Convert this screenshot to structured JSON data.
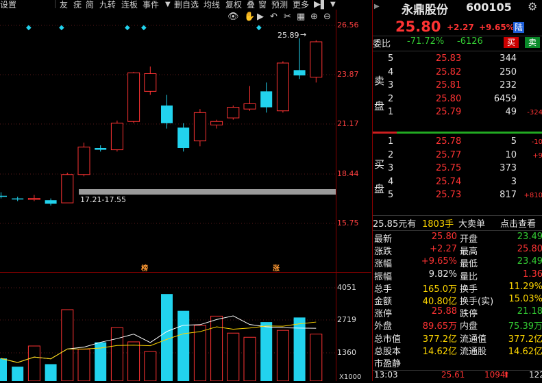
{
  "toolbar": {
    "items": [
      "设置",
      "友",
      "疣",
      "简",
      "九转",
      "连板",
      "事件",
      "删自选",
      "均线",
      "复权",
      "叠",
      "窗",
      "预测",
      "更多"
    ]
  },
  "chart": {
    "price_labels": [
      "26.56",
      "23.87",
      "21.17",
      "18.44",
      "15.75"
    ],
    "volume_labels": [
      "4051",
      "2719",
      "1360",
      "X1000"
    ],
    "high_label": "25.89",
    "range_label": "17.21-17.55",
    "bottom_markers": [
      "榜",
      "涨"
    ],
    "colors": {
      "up": "#ff3333",
      "down": "#22d3ee",
      "ma1": "#ffffff",
      "ma2": "#ffd700"
    }
  },
  "chart_data": {
    "type": "candlestick",
    "candles": [
      {
        "o": 17.1,
        "c": 17.05,
        "h": 17.3,
        "l": 16.95
      },
      {
        "o": 16.95,
        "c": 16.9,
        "h": 17.05,
        "l": 16.8
      },
      {
        "o": 16.9,
        "c": 16.95,
        "h": 17.15,
        "l": 16.8
      },
      {
        "o": 16.85,
        "c": 16.65,
        "h": 16.95,
        "l": 16.55
      },
      {
        "o": 16.7,
        "c": 18.3,
        "h": 18.4,
        "l": 16.7
      },
      {
        "o": 18.3,
        "c": 19.85,
        "h": 20.1,
        "l": 18.2
      },
      {
        "o": 19.8,
        "c": 19.7,
        "h": 19.95,
        "l": 19.6
      },
      {
        "o": 19.7,
        "c": 21.2,
        "h": 21.35,
        "l": 19.6
      },
      {
        "o": 21.3,
        "c": 24.05,
        "h": 24.1,
        "l": 21.2
      },
      {
        "o": 23.0,
        "c": 24.0,
        "h": 24.4,
        "l": 22.8
      },
      {
        "o": 22.2,
        "c": 21.2,
        "h": 22.8,
        "l": 20.9
      },
      {
        "o": 20.95,
        "c": 19.8,
        "h": 21.2,
        "l": 19.6
      },
      {
        "o": 20.2,
        "c": 21.8,
        "h": 22.0,
        "l": 19.9
      },
      {
        "o": 21.1,
        "c": 21.3,
        "h": 21.4,
        "l": 20.9
      },
      {
        "o": 21.5,
        "c": 22.1,
        "h": 22.2,
        "l": 21.4
      },
      {
        "o": 22.0,
        "c": 22.3,
        "h": 23.3,
        "l": 21.9
      },
      {
        "o": 23.0,
        "c": 22.1,
        "h": 23.5,
        "l": 21.8
      },
      {
        "o": 21.9,
        "c": 24.6,
        "h": 24.7,
        "l": 21.8
      },
      {
        "o": 24.2,
        "c": 23.9,
        "h": 26.0,
        "l": 23.7
      },
      {
        "o": 23.8,
        "c": 25.8,
        "h": 25.89,
        "l": 23.5
      }
    ],
    "volume": [
      980,
      620,
      1520,
      730,
      3100,
      1380,
      1680,
      2320,
      1700,
      1280,
      3780,
      3050,
      2420,
      2820,
      2080,
      1900,
      2560,
      2200,
      2760,
      2040
    ],
    "ylim": [
      15.0,
      27.0
    ],
    "vol_max": 4500
  },
  "stock": {
    "name": "永鼎股份",
    "code": "600105",
    "price": "25.80",
    "change": "+2.27",
    "change_pct": "+9.65%",
    "badge": "陆",
    "weibi_label": "委比",
    "weibi": "-71.72%",
    "weicha": "-6126",
    "buy_btn": "买",
    "sell_btn": "卖"
  },
  "orderbook": {
    "sell_label": [
      "卖",
      "盘"
    ],
    "buy_label": [
      "买",
      "盘"
    ],
    "sells": [
      {
        "level": "5",
        "price": "25.83",
        "vol": "344",
        "delta": ""
      },
      {
        "level": "4",
        "price": "25.82",
        "vol": "250",
        "delta": ""
      },
      {
        "level": "3",
        "price": "25.81",
        "vol": "232",
        "delta": ""
      },
      {
        "level": "2",
        "price": "25.80",
        "vol": "6459",
        "delta": ""
      },
      {
        "level": "1",
        "price": "25.79",
        "vol": "49",
        "delta": "-324"
      }
    ],
    "buys": [
      {
        "level": "1",
        "price": "25.78",
        "vol": "5",
        "delta": "-10"
      },
      {
        "level": "2",
        "price": "25.77",
        "vol": "10",
        "delta": "+9"
      },
      {
        "level": "3",
        "price": "25.75",
        "vol": "373",
        "delta": ""
      },
      {
        "level": "4",
        "price": "25.74",
        "vol": "3",
        "delta": ""
      },
      {
        "level": "5",
        "price": "25.73",
        "vol": "817",
        "delta": "+810"
      }
    ]
  },
  "trade": {
    "last_price": "25.85元有",
    "last_vol": "1803手",
    "big_order": "大卖单",
    "view_link": "点击查看"
  },
  "stats": [
    {
      "l1": "最新",
      "v1": "25.80",
      "c1": "red",
      "l2": "开盘",
      "v2": "23.49",
      "c2": "green"
    },
    {
      "l1": "涨跌",
      "v1": "+2.27",
      "c1": "red",
      "l2": "最高",
      "v2": "25.80",
      "c2": "red"
    },
    {
      "l1": "涨幅",
      "v1": "+9.65%",
      "c1": "red",
      "l2": "最低",
      "v2": "23.49",
      "c2": "green"
    },
    {
      "l1": "振幅",
      "v1": "9.82%",
      "c1": "white",
      "l2": "量比",
      "v2": "1.36",
      "c2": "red"
    },
    {
      "l1": "总手",
      "v1": "165.0万",
      "c1": "yellow",
      "l2": "换手",
      "v2": "11.29%",
      "c2": "yellow"
    },
    {
      "l1": "金额",
      "v1": "40.80亿",
      "c1": "yellow",
      "l2": "换手(实)",
      "v2": "15.03%",
      "c2": "yellow"
    },
    {
      "l1": "涨停",
      "v1": "25.88",
      "c1": "red",
      "l2": "跌停",
      "v2": "21.18",
      "c2": "green"
    },
    {
      "l1": "外盘",
      "v1": "89.65万",
      "c1": "red",
      "l2": "内盘",
      "v2": "75.39万",
      "c2": "green"
    },
    {
      "l1": "总市值",
      "v1": "377.2亿",
      "c1": "yellow",
      "l2": "流通值",
      "v2": "377.2亿",
      "c2": "yellow"
    },
    {
      "l1": "总股本",
      "v1": "14.62亿",
      "c1": "yellow",
      "l2": "流通股",
      "v2": "14.62亿",
      "c2": "yellow"
    },
    {
      "l1": "市盈静",
      "v1": "",
      "c1": "white",
      "l2": "",
      "v2": "",
      "c2": "white"
    }
  ],
  "tick": {
    "time": "13:03",
    "price": "25.61",
    "vol": "1094",
    "extra": "122"
  }
}
